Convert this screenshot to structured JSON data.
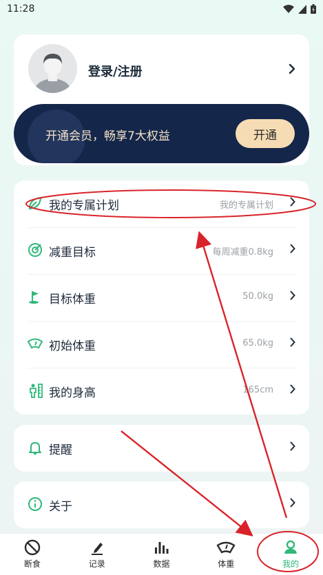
{
  "status": {
    "time": "11:28"
  },
  "profile": {
    "login_label": "登录/注册"
  },
  "vip": {
    "text": "开通会员，畅享7大权益",
    "button": "开通"
  },
  "menu": [
    {
      "label": "我的专属计划",
      "value": "我的专属计划",
      "icon": "leaf-icon"
    },
    {
      "label": "减重目标",
      "value": "每周减重0.8kg",
      "icon": "target-icon"
    },
    {
      "label": "目标体重",
      "value": "50.0kg",
      "icon": "flag-icon"
    },
    {
      "label": "初始体重",
      "value": "65.0kg",
      "icon": "scale-icon"
    },
    {
      "label": "我的身高",
      "value": "165cm",
      "icon": "height-icon"
    }
  ],
  "reminder": {
    "label": "提醒",
    "icon": "bell-icon"
  },
  "about": {
    "label": "关于",
    "icon": "info-icon"
  },
  "tabs": [
    {
      "label": "断食",
      "icon": "ban-icon"
    },
    {
      "label": "记录",
      "icon": "pencil-icon"
    },
    {
      "label": "数据",
      "icon": "bar-chart-icon"
    },
    {
      "label": "体重",
      "icon": "scale-icon"
    },
    {
      "label": "我的",
      "icon": "person-icon",
      "active": true
    }
  ],
  "colors": {
    "accent": "#2fb87a",
    "vip_bg": "#14264a",
    "vip_button": "#f6dcb4",
    "annotation": "#d9232a"
  }
}
